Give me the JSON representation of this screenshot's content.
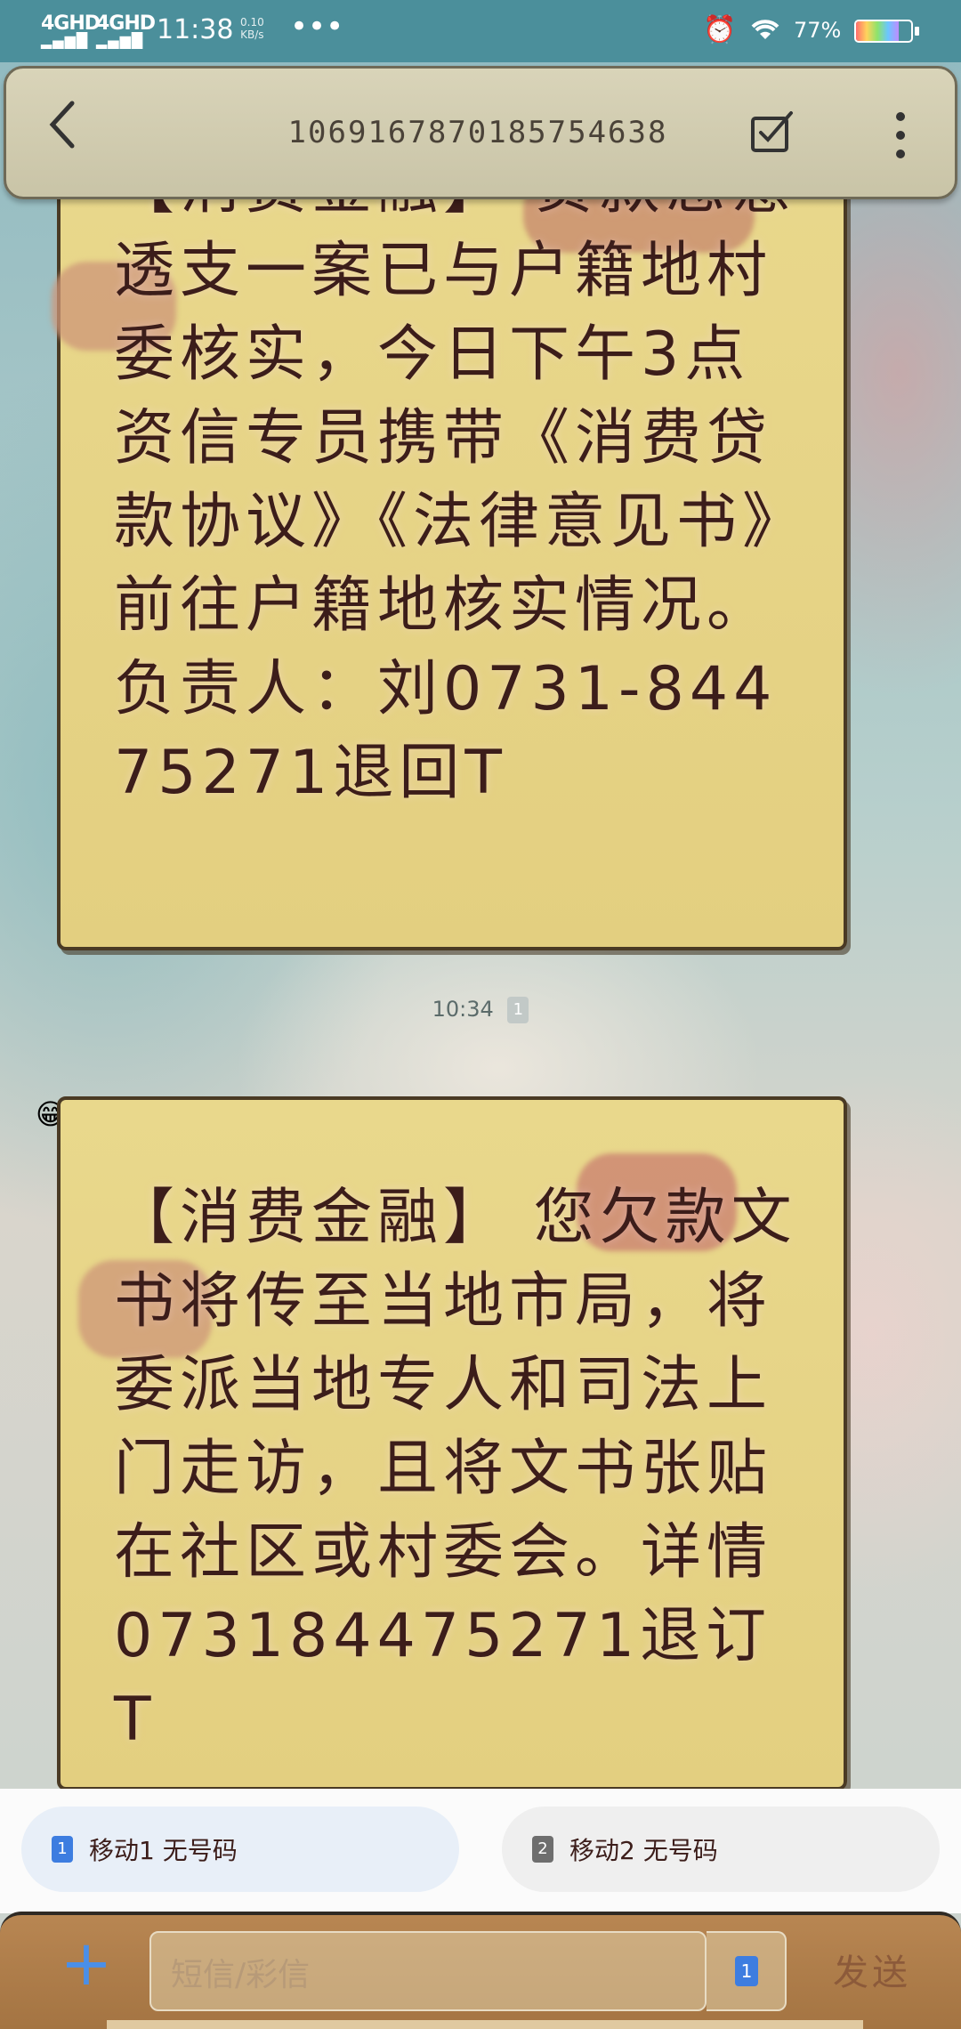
{
  "status_bar": {
    "net1": "4GHD",
    "net2": "4GHD",
    "time": "11:38",
    "speed_value": "0.10",
    "speed_unit": "KB/s",
    "more": "•••",
    "battery_percent": "77%",
    "battery_level": 0.77
  },
  "title_bar": {
    "phone_number": "1069167870185754638"
  },
  "messages": [
    {
      "text": "【消费金融】 贷款恶意透支一案已与户籍地村委核实，今日下午3点资信专员携带《消费贷款协议》《法律意见书》前往户籍地核实情况。负责人：刘0731-84475271退回T"
    },
    {
      "text": "【消费金融】 您欠款文书将传至当地市局，将委派当地专人和司法上门走访，且将文书张贴在社区或村委会。详情073184475271退订T"
    }
  ],
  "timestamp": {
    "time": "10:34",
    "sim": "1"
  },
  "sim_choices": [
    {
      "badge": "1",
      "label": "移动1 无号码"
    },
    {
      "badge": "2",
      "label": "移动2 无号码"
    }
  ],
  "compose": {
    "add": "+",
    "placeholder": "短信/彩信",
    "sim_badge": "1",
    "send_label": "发送"
  },
  "colors": {
    "bubble": "#e6d486",
    "status_bar": "#4b8f9b",
    "text": "#3c1d1a",
    "accent_blue": "#3d7de0"
  }
}
